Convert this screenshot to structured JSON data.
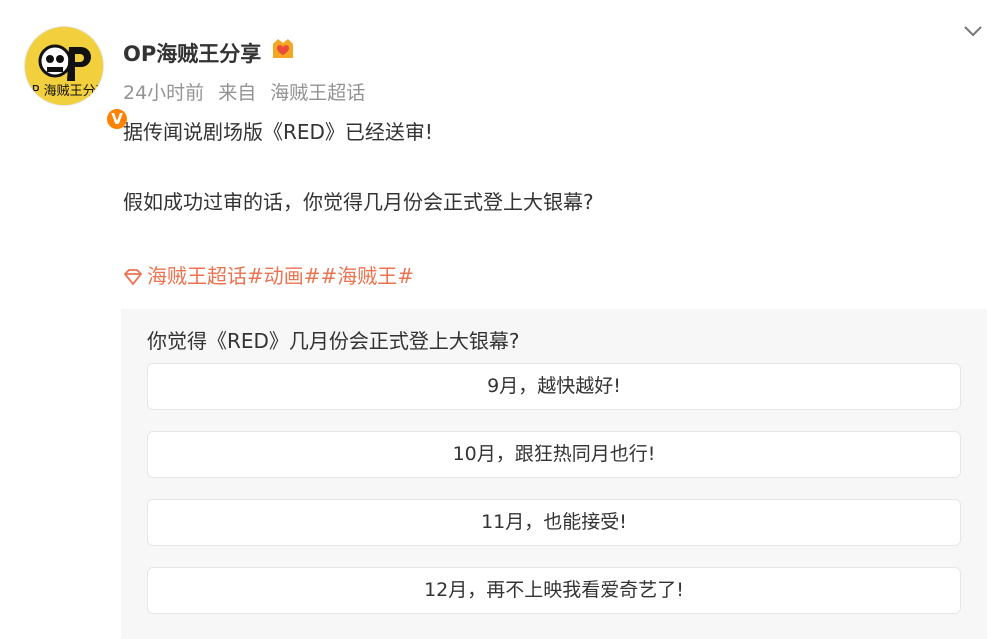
{
  "post": {
    "username": "OP海贼王分享",
    "avatar_text": "OP 海贼王分享",
    "time": "24小时前",
    "source_prefix": "来自",
    "source": "海贼王超话",
    "content": [
      "据传闻说剧场版《RED》已经送审!",
      "假如成功过审的话，你觉得几月份会正式登上大银幕?"
    ],
    "topics": "海贼王超话#动画##海贼王#"
  },
  "poll": {
    "question": "你觉得《RED》几月份会正式登上大银幕?",
    "options": [
      "9月，越快越好!",
      "10月，跟狂热同月也行!",
      "11月，也能接受!",
      "12月，再不上映我看爱奇艺了!"
    ]
  },
  "colors": {
    "accent": "#eb7350",
    "verified": "#ff8200",
    "meta": "#939393"
  },
  "icons": {
    "verified": "verified-v-icon",
    "badge": "fan-badge-icon",
    "menu": "chevron-down-icon",
    "topic": "diamond-icon"
  }
}
